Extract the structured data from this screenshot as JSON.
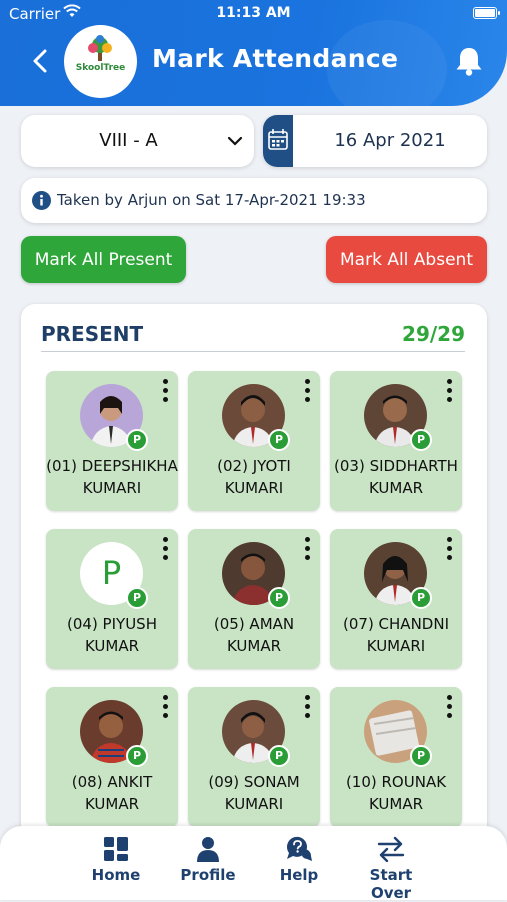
{
  "status_bar": {
    "carrier": "Carrier",
    "time": "11:13 AM"
  },
  "header": {
    "title": "Mark Attendance",
    "logo_text": "SkoolTree"
  },
  "filters": {
    "class": "VIII - A",
    "date": "16 Apr 2021"
  },
  "info": {
    "text": "Taken by Arjun on Sat 17-Apr-2021 19:33"
  },
  "actions": {
    "mark_all_present": "Mark All Present",
    "mark_all_absent": "Mark All Absent"
  },
  "section": {
    "title": "PRESENT",
    "count": "29/29"
  },
  "students": [
    {
      "line1": "(01) DEEPSHIKHA",
      "line2": "KUMARI",
      "badge": "P",
      "avatar_color": "#b9a6d8",
      "avatar_type": "photo"
    },
    {
      "line1": "(02) JYOTI",
      "line2": "KUMARI",
      "badge": "P",
      "avatar_color": "#6b4a3a",
      "avatar_type": "photo"
    },
    {
      "line1": "(03) SIDDHARTH",
      "line2": "KUMAR",
      "badge": "P",
      "avatar_color": "#5f4536",
      "avatar_type": "photo"
    },
    {
      "line1": "(04) PIYUSH",
      "line2": "KUMAR",
      "badge": "P",
      "avatar_letter": "P",
      "avatar_type": "letter"
    },
    {
      "line1": "(05) AMAN",
      "line2": "KUMAR",
      "badge": "P",
      "avatar_color": "#4e3a2e",
      "avatar_type": "photo"
    },
    {
      "line1": "(07) CHANDNI",
      "line2": "KUMARI",
      "badge": "P",
      "avatar_color": "#5a4233",
      "avatar_type": "photo"
    },
    {
      "line1": "(08) ANKIT",
      "line2": "KUMAR",
      "badge": "P",
      "avatar_color": "#6a3c2e",
      "avatar_type": "photo"
    },
    {
      "line1": "(09) SONAM",
      "line2": "KUMARI",
      "badge": "P",
      "avatar_color": "#6b4c3c",
      "avatar_type": "photo"
    },
    {
      "line1": "(10) ROUNAK",
      "line2": "KUMAR",
      "badge": "P",
      "avatar_color": "#c9a27d",
      "avatar_type": "photo"
    }
  ],
  "bottom_nav": [
    {
      "label": "Home",
      "icon": "grid-icon"
    },
    {
      "label": "Profile",
      "icon": "person-icon"
    },
    {
      "label": "Help",
      "icon": "help-chat-icon"
    },
    {
      "label": "Start Over",
      "icon": "swap-arrows-icon"
    }
  ],
  "colors": {
    "brand_blue": "#1a6fd8",
    "present_green": "#2fa63a",
    "absent_red": "#e84a3f",
    "tile_green": "#c9e4c5"
  }
}
